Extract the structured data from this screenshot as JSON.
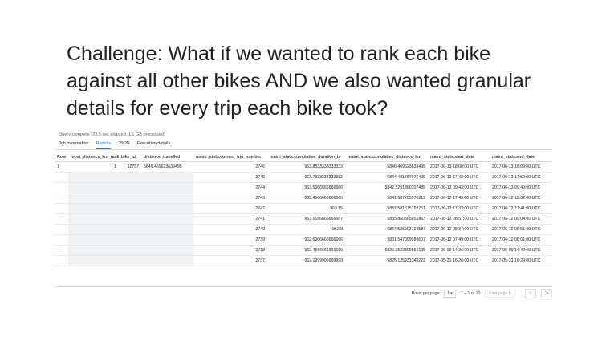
{
  "slide": {
    "title_lines": [
      "Challenge: What if we wanted to rank each bike",
      "against all other bikes AND we also wanted granular",
      "details for every trip each bike took?"
    ]
  },
  "console": {
    "status": "Query complete (23.5 sec elapsed, 1.1 GB processed)",
    "tabs": [
      "Job information",
      "Results",
      "JSON",
      "Execution details"
    ],
    "active_tab": "Results",
    "columns": [
      "Row",
      "most_distance_km_rank",
      "bike_id",
      "distance_travelled",
      "maint_stats.current_trip_number",
      "maint_stats.cumulative_duration_hr",
      "maint_stats.cumulative_distance_km",
      "maint_stats.start_date",
      "maint_stats.end_date"
    ],
    "first_row": {
      "row": "1",
      "rank": "1",
      "bike_id": "12757",
      "distance": "5846.469623639495"
    },
    "rows": [
      {
        "trip": "2746",
        "duration": "963.8833333333333",
        "distance": "5846.469623639495",
        "start": "2017-06-13 18:00:00 UTC",
        "end": "2017-06-13 18:09:00 UTC"
      },
      {
        "trip": "2745",
        "duration": "963.7333333333332",
        "distance": "5844.421787976495",
        "start": "2017-06-13 17:42:00 UTC",
        "end": "2017-06-13 17:52:00 UTC"
      },
      {
        "trip": "2744",
        "duration": "963.5666666666666",
        "distance": "5842.5291360107485",
        "start": "2017-06-13 09:43:00 UTC",
        "end": "2017-06-13 09:49:00 UTC"
      },
      {
        "trip": "2743",
        "duration": "963.4666666666666",
        "distance": "5841.687255976212",
        "start": "2017-06-12 17:43:00 UTC",
        "end": "2017-06-12 18:02:00 UTC"
      },
      {
        "trip": "2742",
        "duration": "963.15",
        "distance": "5837.581675192751",
        "start": "2017-06-12 17:33:00 UTC",
        "end": "2017-06-12 17:41:00 UTC"
      },
      {
        "trip": "2741",
        "duration": "963.0166666666667",
        "distance": "5835.860305651863",
        "start": "2017-06-12 08:57:00 UTC",
        "end": "2017-06-12 09:04:00 UTC"
      },
      {
        "trip": "2740",
        "duration": "962.9",
        "distance": "5834.536903703587",
        "start": "2017-06-12 08:37:00 UTC",
        "end": "2017-06-12 08:51:00 UTC"
      },
      {
        "trip": "2739",
        "duration": "962.6666666666666",
        "distance": "5831.547099983607",
        "start": "2017-06-12 07:49:00 UTC",
        "end": "2017-06-12 08:01:00 UTC"
      },
      {
        "trip": "2738",
        "duration": "962.4666666666666",
        "distance": "5829.3522309666105",
        "start": "2017-06-09 14:26:00 UTC",
        "end": "2017-06-09 14:42:00 UTC"
      },
      {
        "trip": "2737",
        "duration": "962.1999999999999",
        "distance": "5825.135931342222",
        "start": "2017-05-31 16:26:00 UTC",
        "end": "2017-05-31 16:29:00 UTC"
      }
    ],
    "pager": {
      "rows_label": "Rows per page:",
      "rows_value": "1",
      "range": "1 – 1 of 10",
      "first_page": "First page",
      "prev": "<",
      "next": ">"
    }
  }
}
